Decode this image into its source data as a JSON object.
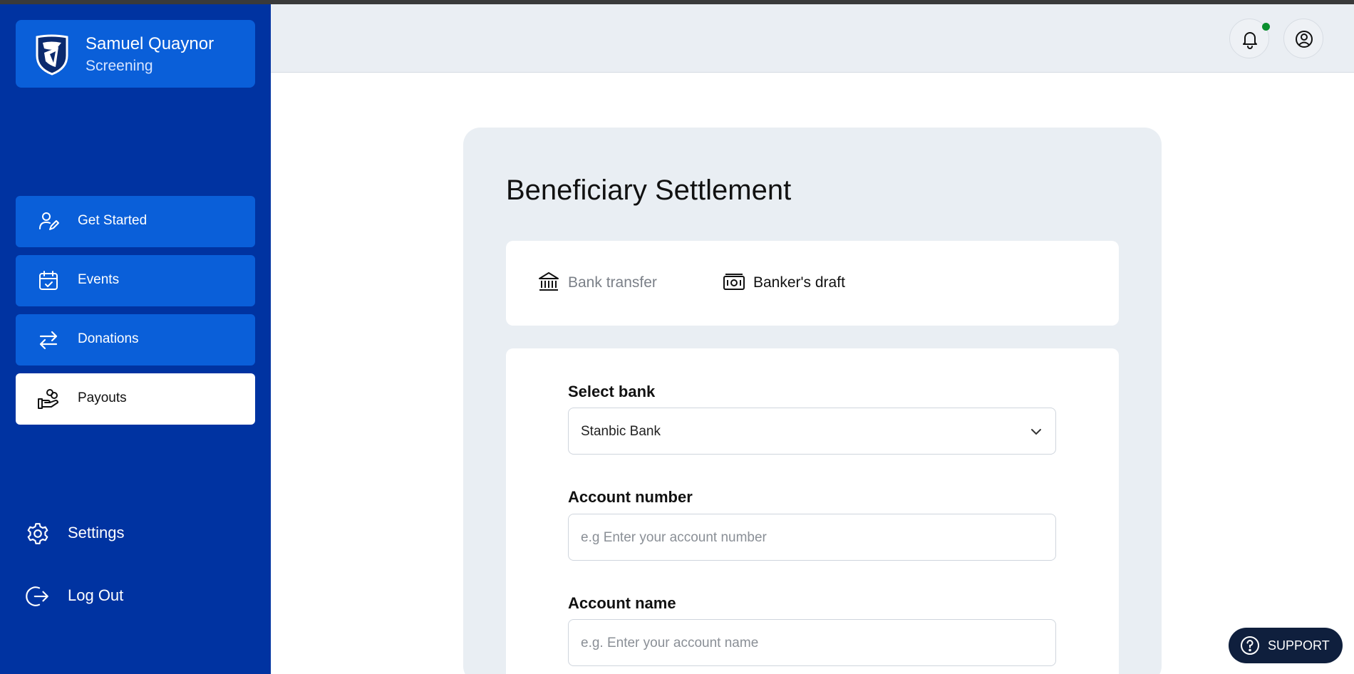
{
  "profile": {
    "name": "Samuel Quaynor",
    "role": "Screening"
  },
  "sidebar": {
    "items": [
      {
        "label": "Get Started",
        "icon": "user-edit-icon"
      },
      {
        "label": "Events",
        "icon": "calendar-check-icon"
      },
      {
        "label": "Donations",
        "icon": "transfer-arrows-icon"
      },
      {
        "label": "Payouts",
        "icon": "hand-coins-icon",
        "active": true
      }
    ],
    "bottom": [
      {
        "label": "Settings",
        "icon": "gear-icon"
      },
      {
        "label": "Log Out",
        "icon": "logout-icon"
      }
    ]
  },
  "header": {
    "has_notification": true
  },
  "main": {
    "title": "Beneficiary Settlement",
    "tabs": [
      {
        "label": "Bank transfer",
        "icon": "bank-icon",
        "active": false
      },
      {
        "label": "Banker's draft",
        "icon": "banknote-icon",
        "active": true
      }
    ],
    "form": {
      "bank": {
        "label": "Select bank",
        "value": "Stanbic Bank"
      },
      "account_number": {
        "label": "Account number",
        "placeholder": "e.g Enter your account number"
      },
      "account_name": {
        "label": "Account name",
        "placeholder": "e.g. Enter your account name"
      }
    }
  },
  "support": {
    "label": "SUPPORT"
  },
  "colors": {
    "sidebar": "#0033a1",
    "nav_item": "#0a5fd9",
    "support": "#0f1f3d",
    "notification_dot": "#0a8f2e"
  }
}
